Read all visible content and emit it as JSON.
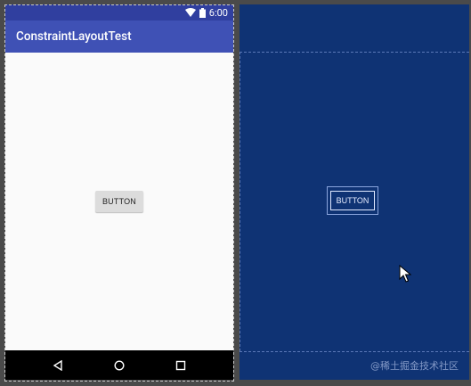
{
  "status_bar": {
    "time": "6:00"
  },
  "app_bar": {
    "title": "ConstraintLayoutTest"
  },
  "preview": {
    "button_label": "BUTTON"
  },
  "blueprint": {
    "button_label": "BUTTON"
  },
  "watermark": "@稀土掘金技术社区",
  "colors": {
    "status_bar": "#303f9f",
    "app_bar": "#3f51b5",
    "blueprint_bg": "#0f3374",
    "button_bg": "#dcdcdc"
  }
}
